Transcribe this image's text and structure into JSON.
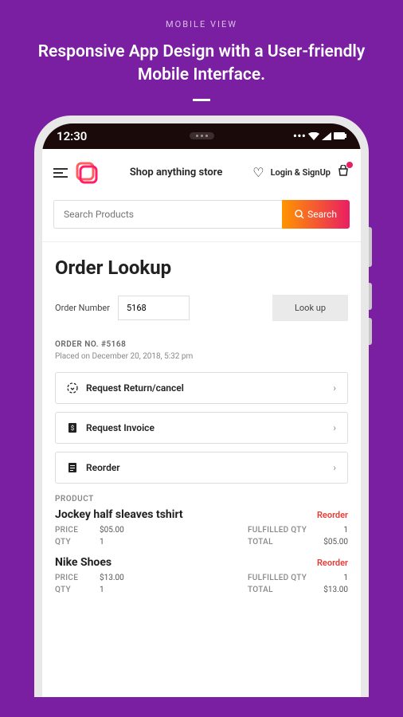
{
  "promo": {
    "label": "MOBILE VIEW",
    "headline": "Responsive App Design with a User-friendly Mobile Interface."
  },
  "statusbar": {
    "time": "12:30"
  },
  "header": {
    "store_name": "Shop anything store",
    "login_text": "Login & SignUp"
  },
  "search": {
    "placeholder": "Search Products",
    "button": "Search"
  },
  "page": {
    "title": "Order Lookup",
    "order_number_label": "Order Number",
    "order_number_value": "5168",
    "lookup_button": "Look up"
  },
  "order": {
    "number_label": "ORDER NO. #5168",
    "placed": "Placed on December 20, 2018, 5:32 pm"
  },
  "actions": [
    {
      "label": "Request Return/cancel"
    },
    {
      "label": "Request Invoice"
    },
    {
      "label": "Reorder"
    }
  ],
  "products_label": "PRODUCT",
  "labels": {
    "price": "PRICE",
    "qty": "QTY",
    "fulfilled_qty": "FULFILLED QTY",
    "total": "TOTAL",
    "reorder": "Reorder"
  },
  "products": [
    {
      "name": "Jockey half sleaves tshirt",
      "price": "$05.00",
      "qty": "1",
      "fulfilled": "1",
      "total": "$05.00"
    },
    {
      "name": "Nike Shoes",
      "price": "$13.00",
      "qty": "1",
      "fulfilled": "1",
      "total": "$13.00"
    }
  ]
}
